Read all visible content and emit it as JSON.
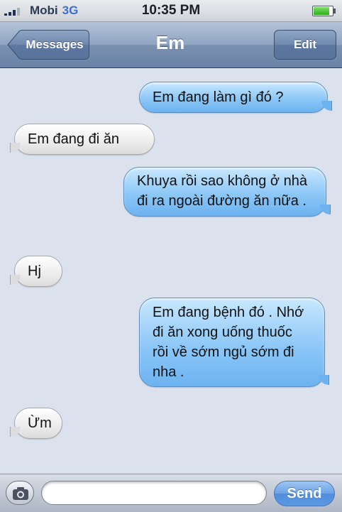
{
  "status_bar": {
    "carrier": "Mobi",
    "network": "3G",
    "time": "10:35 PM"
  },
  "nav": {
    "back_label": "Messages",
    "title": "Em",
    "edit_label": "Edit"
  },
  "messages": [
    {
      "from": "me",
      "text": "Em đang làm gì đó ?"
    },
    {
      "from": "them",
      "text": "Em đang đi ăn"
    },
    {
      "from": "me",
      "text": "Khuya rồi sao không ở nhà đi ra ngoài đường ăn nữa ."
    },
    {
      "from": "them",
      "text": "Hj"
    },
    {
      "from": "me",
      "text": "Em đang bệnh đó . Nhớ đi ăn xong uống thuốc rồi về sớm ngủ sớm đi nha ."
    },
    {
      "from": "them",
      "text": "Ừm"
    }
  ],
  "compose": {
    "input_value": "",
    "send_label": "Send"
  },
  "colors": {
    "outgoing_bubble": "#8cc7f7",
    "incoming_bubble": "#ececec",
    "background": "#dbe2ed",
    "navbar": "#7990b1"
  }
}
